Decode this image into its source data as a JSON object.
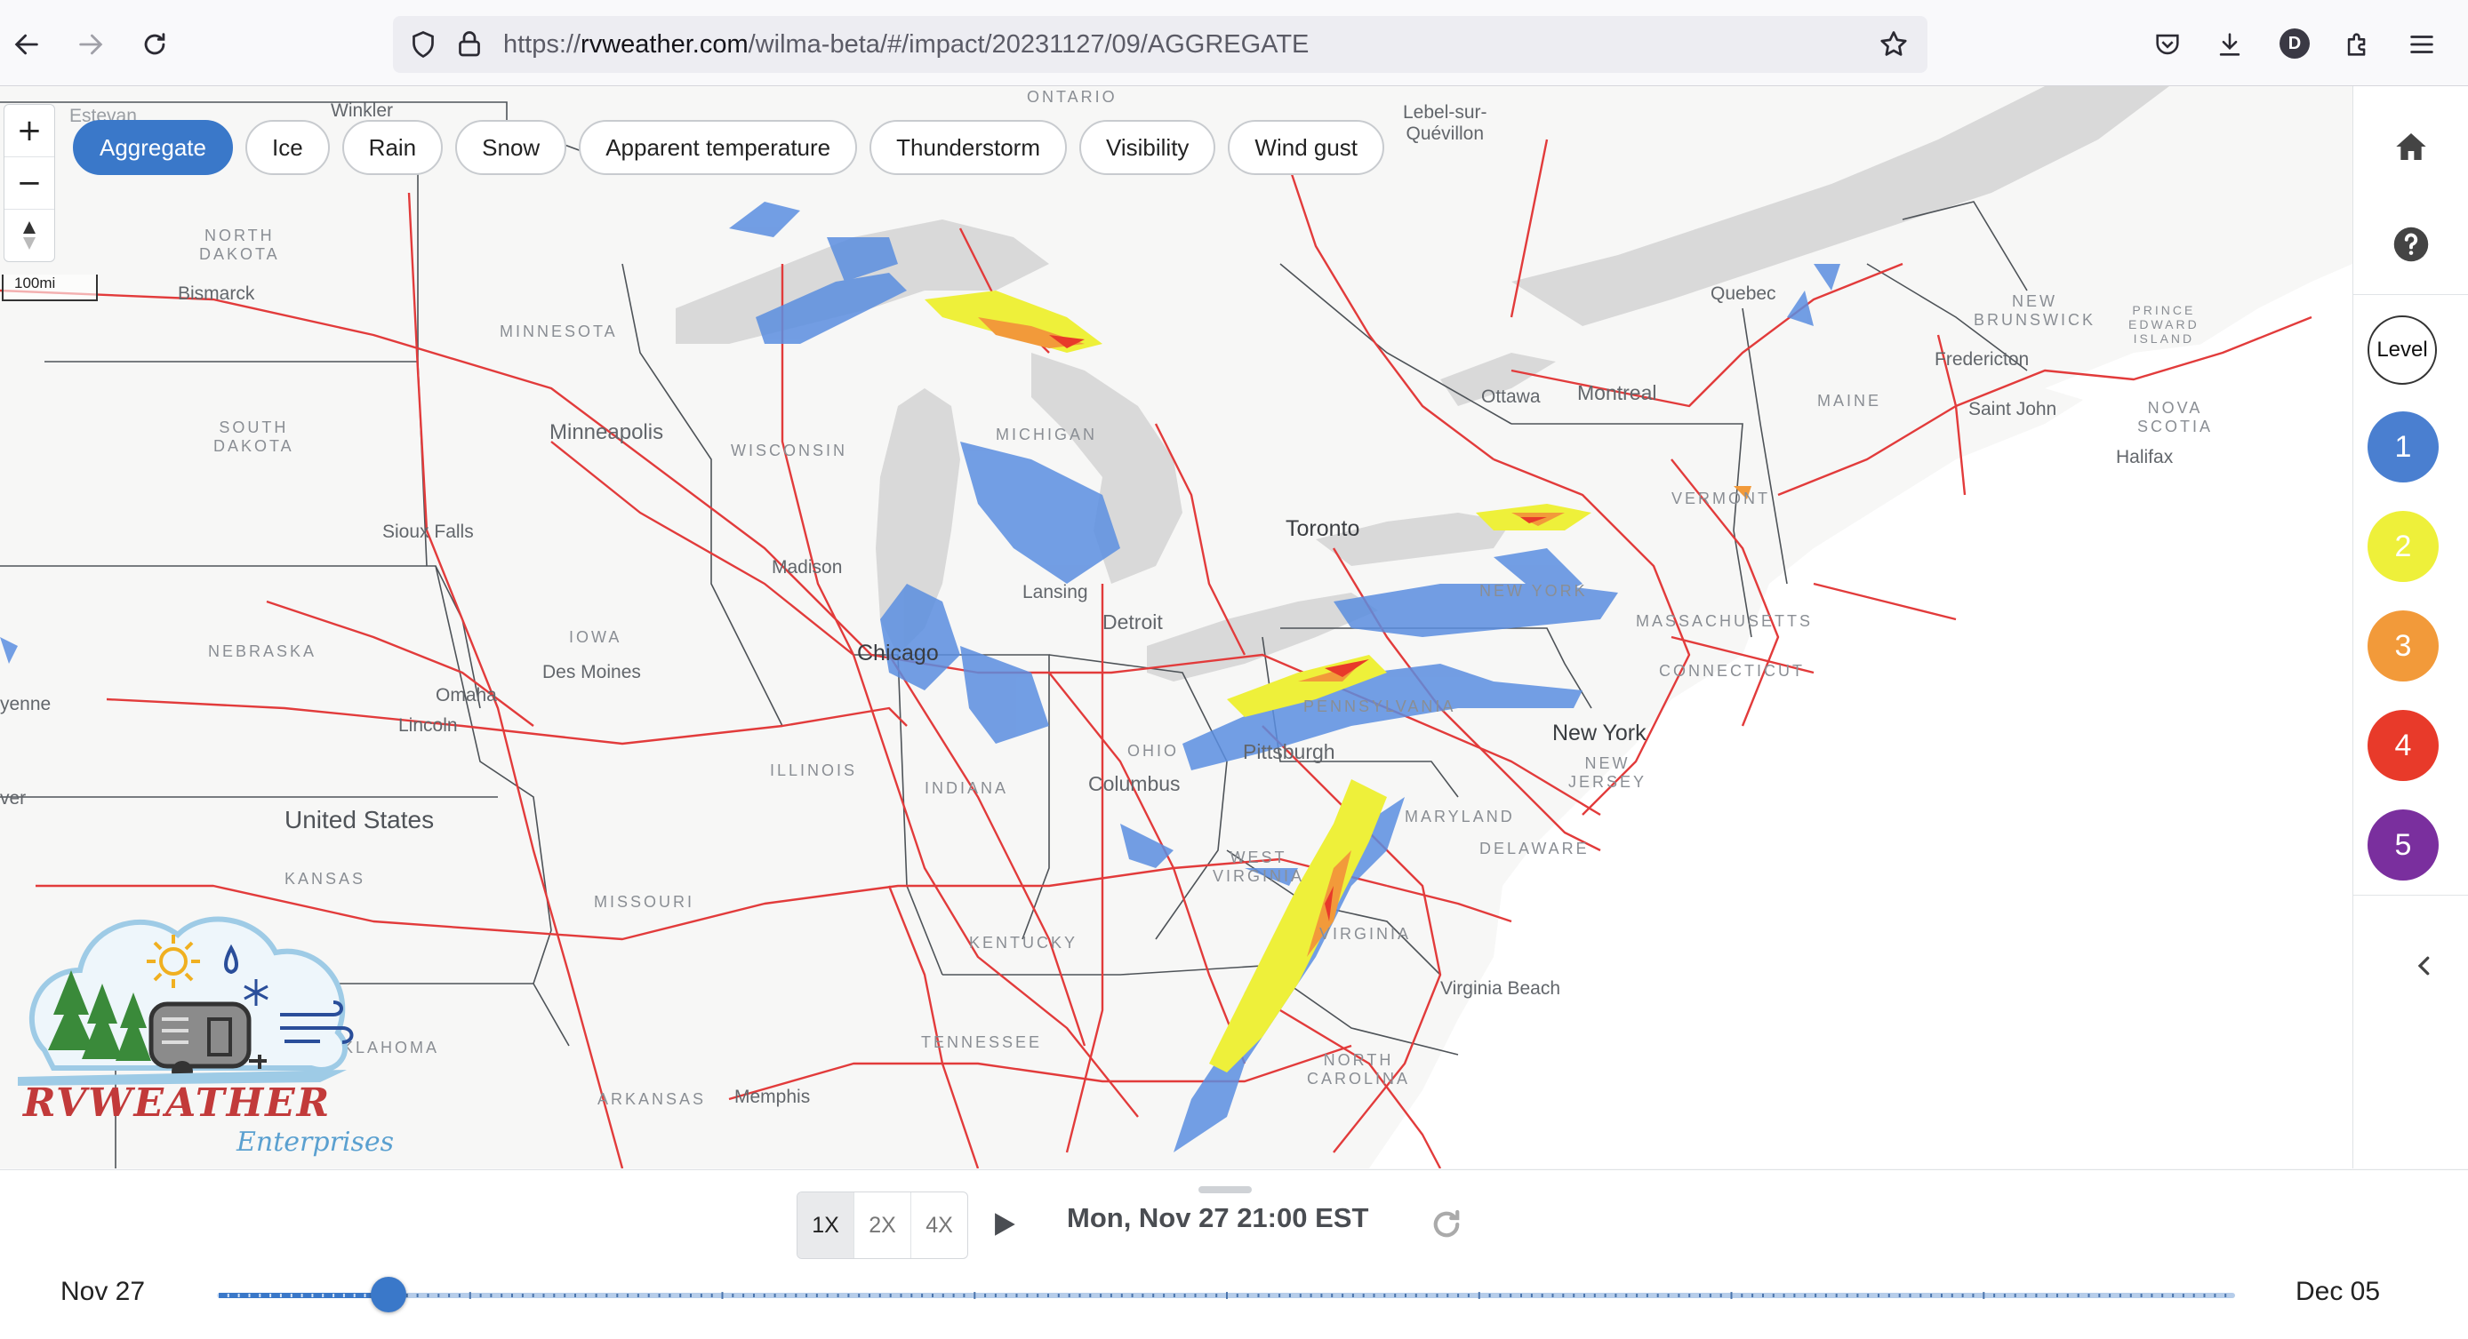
{
  "browser": {
    "url_prefix": "https://",
    "url_domain": "rvweather.com",
    "url_path": "/wilma-beta/#/impact/20231127/09/AGGREGATE",
    "profile_initial": "D"
  },
  "map": {
    "chips": [
      {
        "label": "Aggregate",
        "active": true
      },
      {
        "label": "Ice"
      },
      {
        "label": "Rain"
      },
      {
        "label": "Snow"
      },
      {
        "label": "Apparent temperature"
      },
      {
        "label": "Thunderstorm"
      },
      {
        "label": "Visibility"
      },
      {
        "label": "Wind gust"
      }
    ],
    "scale_label": "100mi",
    "logo": {
      "name_text": "RVWEATHER",
      "sub_text": "Enterprises"
    },
    "labels": {
      "ontario": "ONTARIO",
      "north_dakota": "NORTH\nDAKOTA",
      "south_dakota": "SOUTH\nDAKOTA",
      "minnesota": "MINNESOTA",
      "wisconsin": "WISCONSIN",
      "michigan": "MICHIGAN",
      "iowa": "IOWA",
      "nebraska": "NEBRASKA",
      "illinois": "ILLINOIS",
      "indiana": "INDIANA",
      "ohio": "OHIO",
      "pennsylvania": "PENNSYLVANIA",
      "new_york_state": "NEW YORK",
      "vermont": "VERMONT",
      "maine": "MAINE",
      "massachusetts": "MASSACHUSETTS",
      "connecticut": "CONNECTICUT",
      "new_jersey": "NEW\nJERSEY",
      "maryland": "MARYLAND",
      "delaware": "DELAWARE",
      "west_virginia": "WEST\nVIRGINIA",
      "virginia": "VIRGINIA",
      "kentucky": "KENTUCKY",
      "tennessee": "TENNESSEE",
      "north_carolina": "NORTH\nCAROLINA",
      "missouri": "MISSOURI",
      "kansas": "KANSAS",
      "oklahoma": "OKLAHOMA",
      "arkansas": "ARKANSAS",
      "new_brunswick": "NEW\nBRUNSWICK",
      "pei": "PRINCE\nEDWARD\nISLAND",
      "nova_scotia": "NOVA\nSCOTIA",
      "united_states": "United States",
      "estevan": "Estevan",
      "winkler": "Winkler",
      "bismarck": "Bismarck",
      "minneapolis": "Minneapolis",
      "sioux_falls": "Sioux Falls",
      "madison": "Madison",
      "chicago": "Chicago",
      "lansing": "Lansing",
      "detroit": "Detroit",
      "toronto": "Toronto",
      "ottawa": "Ottawa",
      "montreal": "Montreal",
      "quebec": "Quebec",
      "lebel": "Lebel-sur-\nQuévillon",
      "fredericton": "Fredericton",
      "saint_john": "Saint John",
      "halifax": "Halifax",
      "des_moines": "Des Moines",
      "omaha": "Omaha",
      "lincoln": "Lincoln",
      "cheyenne": "yenne",
      "denver": "ver",
      "columbus": "Columbus",
      "pittsburgh": "Pittsburgh",
      "new_york_city": "New York",
      "virginia_beach": "Virginia Beach",
      "memphis": "Memphis"
    }
  },
  "sidebar": {
    "level_label": "Level",
    "levels": [
      {
        "value": "1",
        "color": "#4a7fd0"
      },
      {
        "value": "2",
        "color": "#eef03a"
      },
      {
        "value": "3",
        "color": "#f29a3a"
      },
      {
        "value": "4",
        "color": "#e83a2a"
      },
      {
        "value": "5",
        "color": "#7a2f9e"
      }
    ]
  },
  "timeline": {
    "speeds": [
      {
        "label": "1X",
        "active": true
      },
      {
        "label": "2X"
      },
      {
        "label": "4X"
      }
    ],
    "current": "Mon, Nov 27 21:00 EST",
    "start": "Nov 27",
    "end": "Dec 05",
    "progress": 0.085
  },
  "colors": {
    "accent": "#3a78c9",
    "highway": "#e23b3b",
    "water": "#d9d9d9"
  }
}
